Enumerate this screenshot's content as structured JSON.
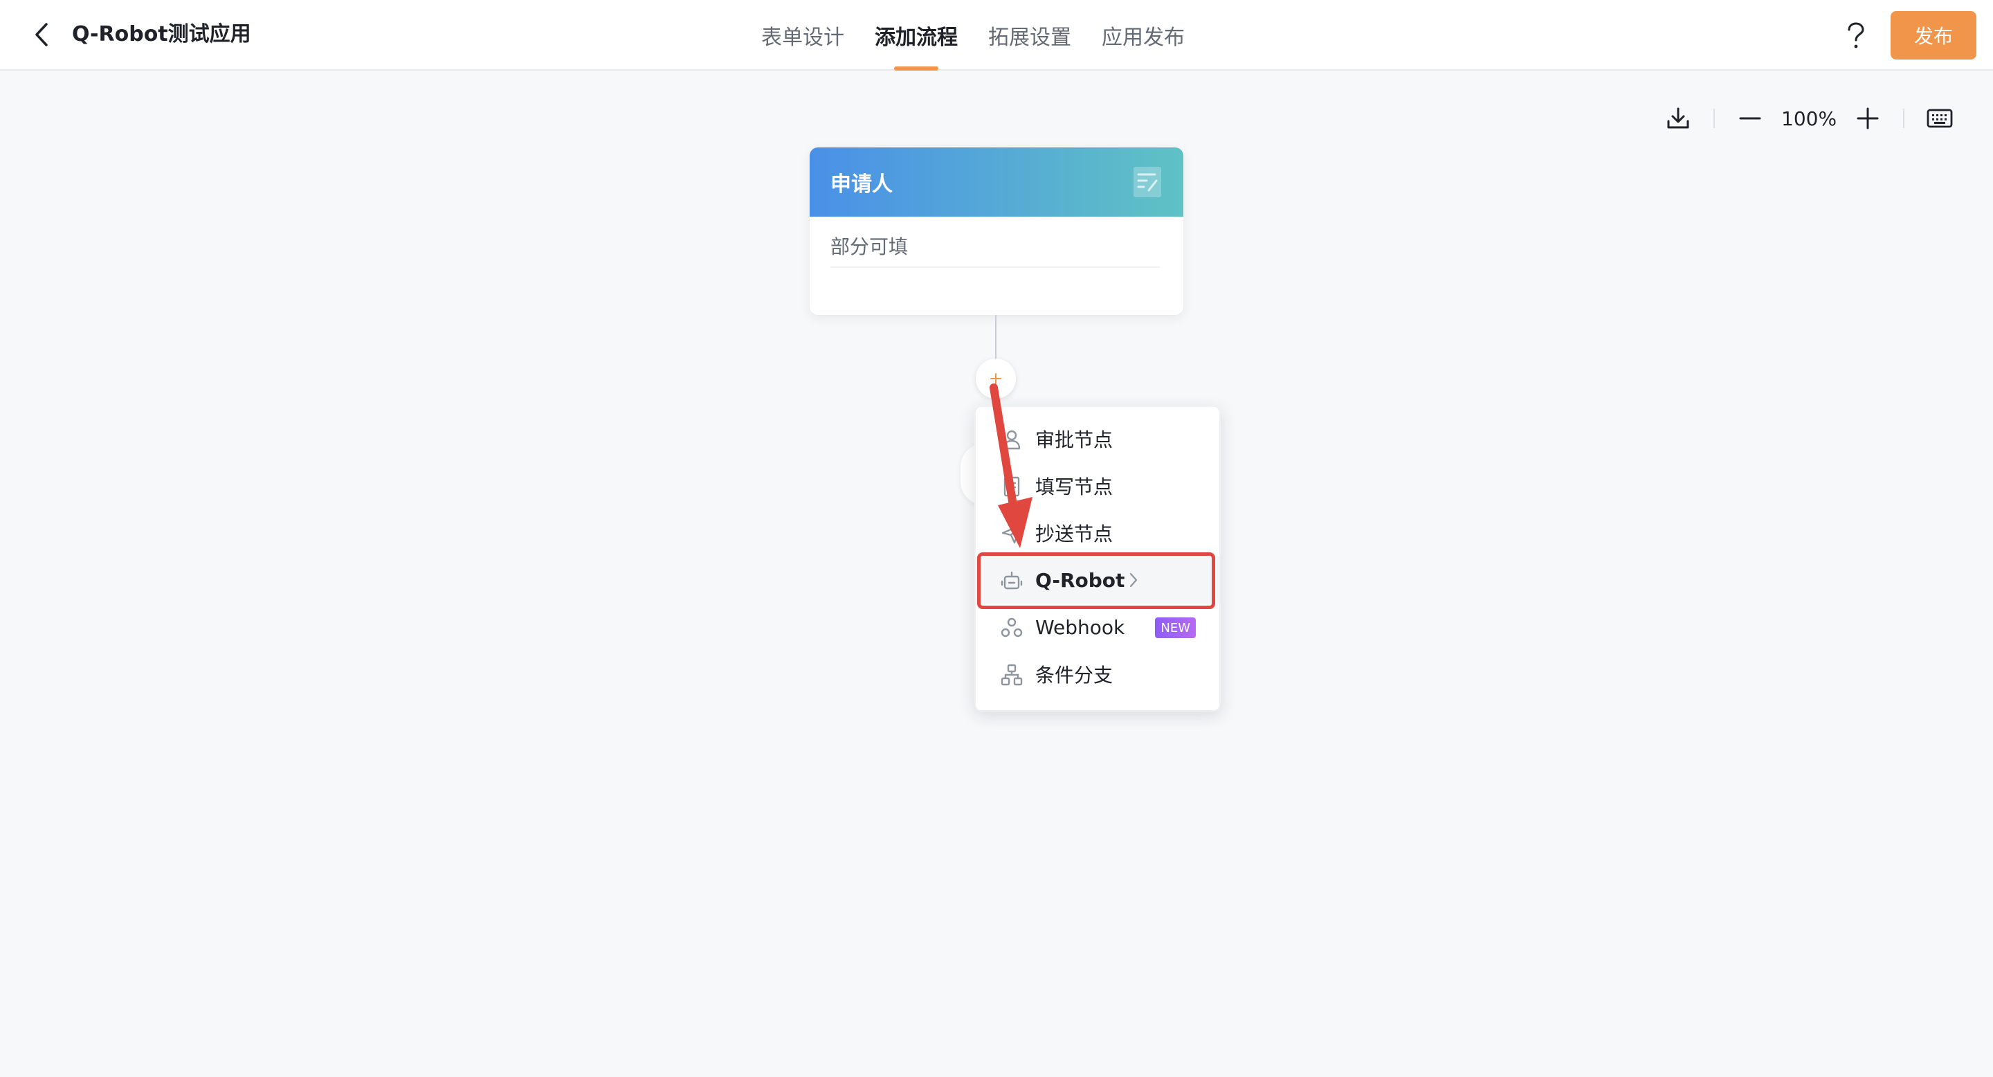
{
  "header": {
    "app_title": "Q-Robot测试应用",
    "tabs": [
      {
        "label": "表单设计",
        "active": false
      },
      {
        "label": "添加流程",
        "active": true
      },
      {
        "label": "拓展设置",
        "active": false
      },
      {
        "label": "应用发布",
        "active": false
      }
    ],
    "publish_label": "发布",
    "help_icon": "question-icon",
    "back_icon": "chevron-left-icon"
  },
  "toolbar": {
    "zoom": "100%",
    "icons": [
      "download-icon",
      "minus-icon",
      "plus-icon",
      "keyboard-icon"
    ]
  },
  "node": {
    "title": "申请人",
    "desc": "部分可填",
    "icon": "form-edit-icon"
  },
  "menu": {
    "items": [
      {
        "label": "审批节点",
        "icon": "user-icon"
      },
      {
        "label": "填写节点",
        "icon": "document-icon"
      },
      {
        "label": "抄送节点",
        "icon": "send-icon"
      },
      {
        "label": "Q-Robot",
        "icon": "robot-icon",
        "highlighted": true
      },
      {
        "label": "Webhook",
        "icon": "webhook-icon",
        "badge": "NEW"
      },
      {
        "label": "条件分支",
        "icon": "branch-icon"
      }
    ]
  },
  "colors": {
    "accent": "#f0954a",
    "highlight_box": "#e0473e",
    "node_gradient_start": "#4a90e8",
    "node_gradient_end": "#5fc2c4",
    "badge": "#8f5cf6"
  }
}
